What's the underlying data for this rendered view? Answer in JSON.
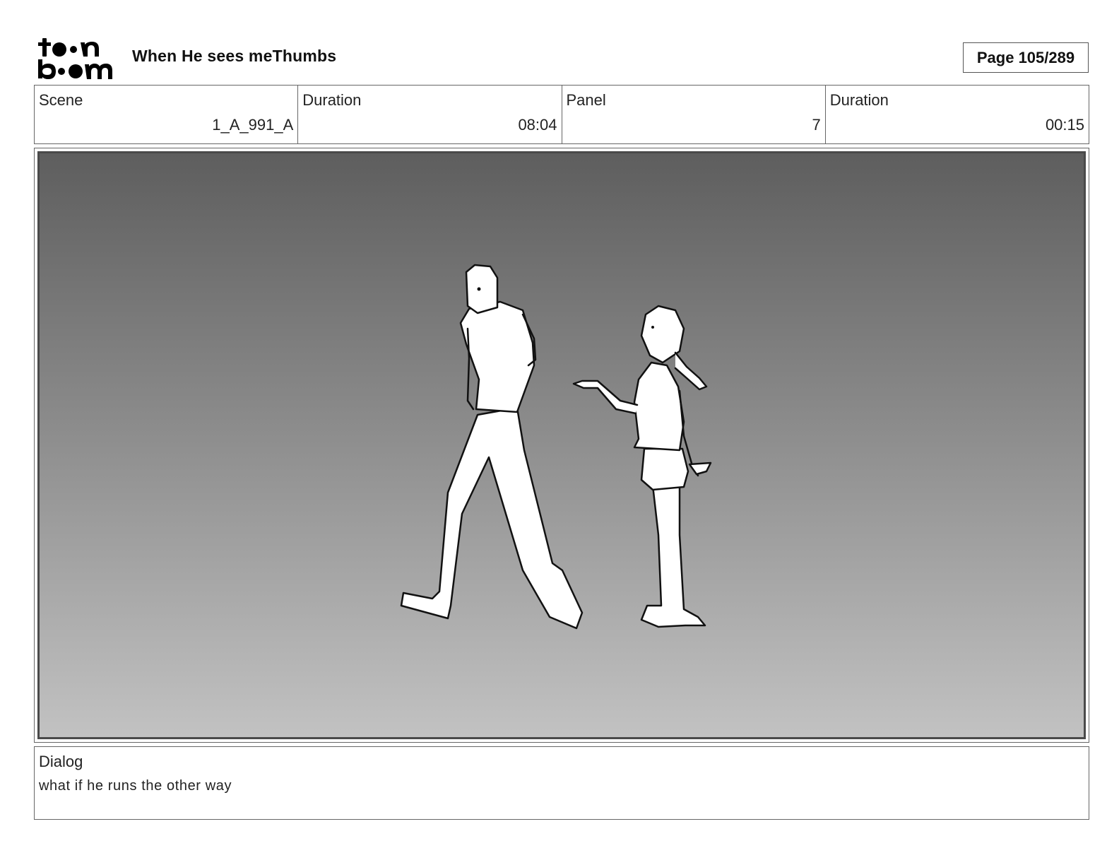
{
  "header": {
    "logo_text_top": "toon",
    "logo_text_bottom": "boom",
    "project_title": "When He sees meThumbs",
    "page_indicator": "Page 105/289"
  },
  "info": {
    "scene_label": "Scene",
    "scene_value": "1_A_991_A",
    "scene_duration_label": "Duration",
    "scene_duration_value": "08:04",
    "panel_label": "Panel",
    "panel_value": "7",
    "panel_duration_label": "Duration",
    "panel_duration_value": "00:15"
  },
  "dialog": {
    "label": "Dialog",
    "text": "what if he runs the other way"
  },
  "colors": {
    "panel_top": "#5e5e5e",
    "panel_bottom": "#c2c2c2",
    "border": "#666666"
  }
}
